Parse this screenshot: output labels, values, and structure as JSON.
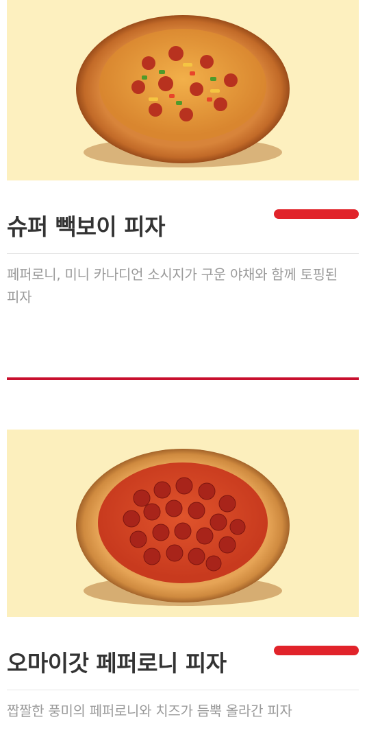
{
  "menu": {
    "items": [
      {
        "name": "슈퍼 빽보이 피자",
        "description": "페퍼로니, 미니 카나디언 소시지가 구운 야채와 함께 토핑된 피자",
        "image_icon": "pizza-image"
      },
      {
        "name": "오마이갓 페퍼로니 피자",
        "description": "짭짤한 풍미의 페퍼로니와 치즈가 듬뿍 올라간 피자",
        "image_icon": "pizza-image"
      }
    ]
  },
  "colors": {
    "accent": "#e1232a",
    "separator": "#c8102e",
    "image_background": "#fdf0bf",
    "title": "#333333",
    "description": "#9a9a9a"
  }
}
